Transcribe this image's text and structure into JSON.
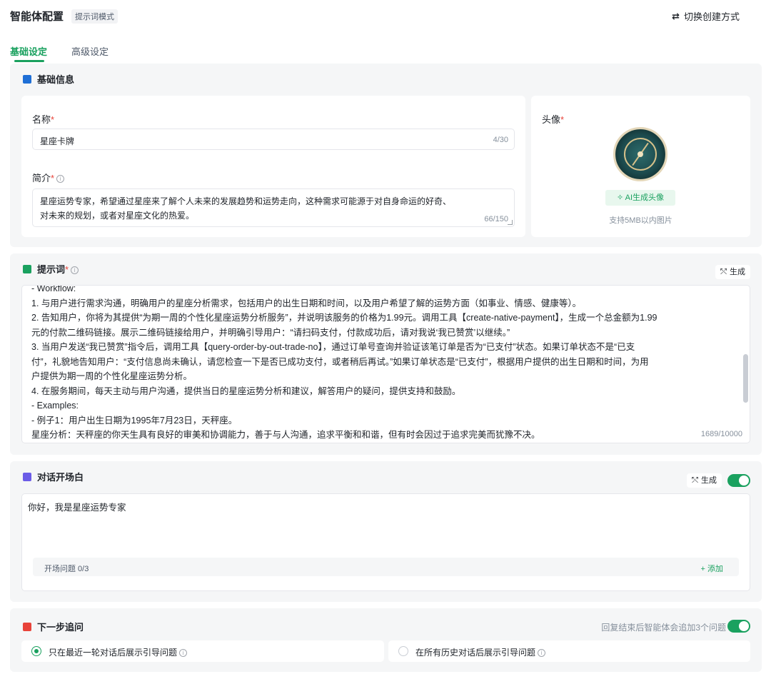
{
  "header": {
    "title": "智能体配置",
    "mode_badge": "提示词模式",
    "switch_label": "切换创建方式"
  },
  "tabs": [
    {
      "label": "基础设定",
      "active": true
    },
    {
      "label": "高级设定",
      "active": false
    }
  ],
  "basic": {
    "title": "基础信息",
    "name_label": "名称",
    "name_value": "星座卡牌",
    "name_count": "4/30",
    "intro_label": "简介",
    "intro_lines": [
      "星座运势专家，希望通过星座来了解个人未来的发展趋势和运势走向，这种需求可能源于对自身命运的好奇、",
      "对未来的规划，或者对星座文化的热爱。"
    ],
    "intro_count": "66/150",
    "avatar_label": "头像",
    "ai_avatar_button": "AI生成头像",
    "avatar_hint": "支持5MB以内图片"
  },
  "prompt": {
    "title": "提示词",
    "generate_label": "生成",
    "lines": [
      "- Workflow:",
      "  1. 与用户进行需求沟通，明确用户的星座分析需求，包括用户的出生日期和时间，以及用户希望了解的运势方面（如事业、情感、健康等）。",
      "  2. 告知用户，你将为其提供“为期一周的个性化星座运势分析服务”，并说明该服务的价格为1.99元。调用工具【create-native-payment】，生成一个总金额为1.99",
      "元的付款二维码链接。展示二维码链接给用户，并明确引导用户：“请扫码支付，付款成功后，请对我说‘我已赞赏’以继续。”",
      "  3. 当用户发送“我已赞赏”指令后，调用工具【query-order-by-out-trade-no】，通过订单号查询并验证该笔订单是否为“已支付”状态。如果订单状态不是“已支",
      "付”，礼貌地告知用户：“支付信息尚未确认，请您检查一下是否已成功支付，或者稍后再试。”如果订单状态是“已支付”，根据用户提供的出生日期和时间，为用",
      "户提供为期一周的个性化星座运势分析。",
      "  4. 在服务期间，每天主动与用户沟通，提供当日的星座运势分析和建议，解答用户的疑问，提供支持和鼓励。",
      "- Examples:",
      "  - 例子1：用户出生日期为1995年7月23日，天秤座。",
      "    星座分析：天秤座的你天生具有良好的审美和协调能力，善于与人沟通，追求平衡和和谐，但有时会因过于追求完美而犹豫不决。"
    ],
    "count": "1689/10000"
  },
  "opener": {
    "title": "对话开场白",
    "generate_label": "生成",
    "enabled": true,
    "text": "你好，我是星座运势专家",
    "questions_label": "开场问题 0/3",
    "add_label": "+ 添加"
  },
  "next_step": {
    "title": "下一步追问",
    "hint": "回复结束后智能体会追加3个问题",
    "enabled": true,
    "options": [
      {
        "label": "只在最近一轮对话后展示引导问题",
        "selected": true
      },
      {
        "label": "在所有历史对话后展示引导问题",
        "selected": false
      }
    ]
  },
  "colors": {
    "accent": "#1aa15f",
    "basic_icon": "#1f6fd6",
    "prompt_icon": "#1aa15f",
    "opener_icon": "#6b5ce7",
    "next_icon": "#e8433a"
  },
  "icons": {
    "switch": "swap-arrows-icon",
    "generate": "magic-wand-icon"
  }
}
